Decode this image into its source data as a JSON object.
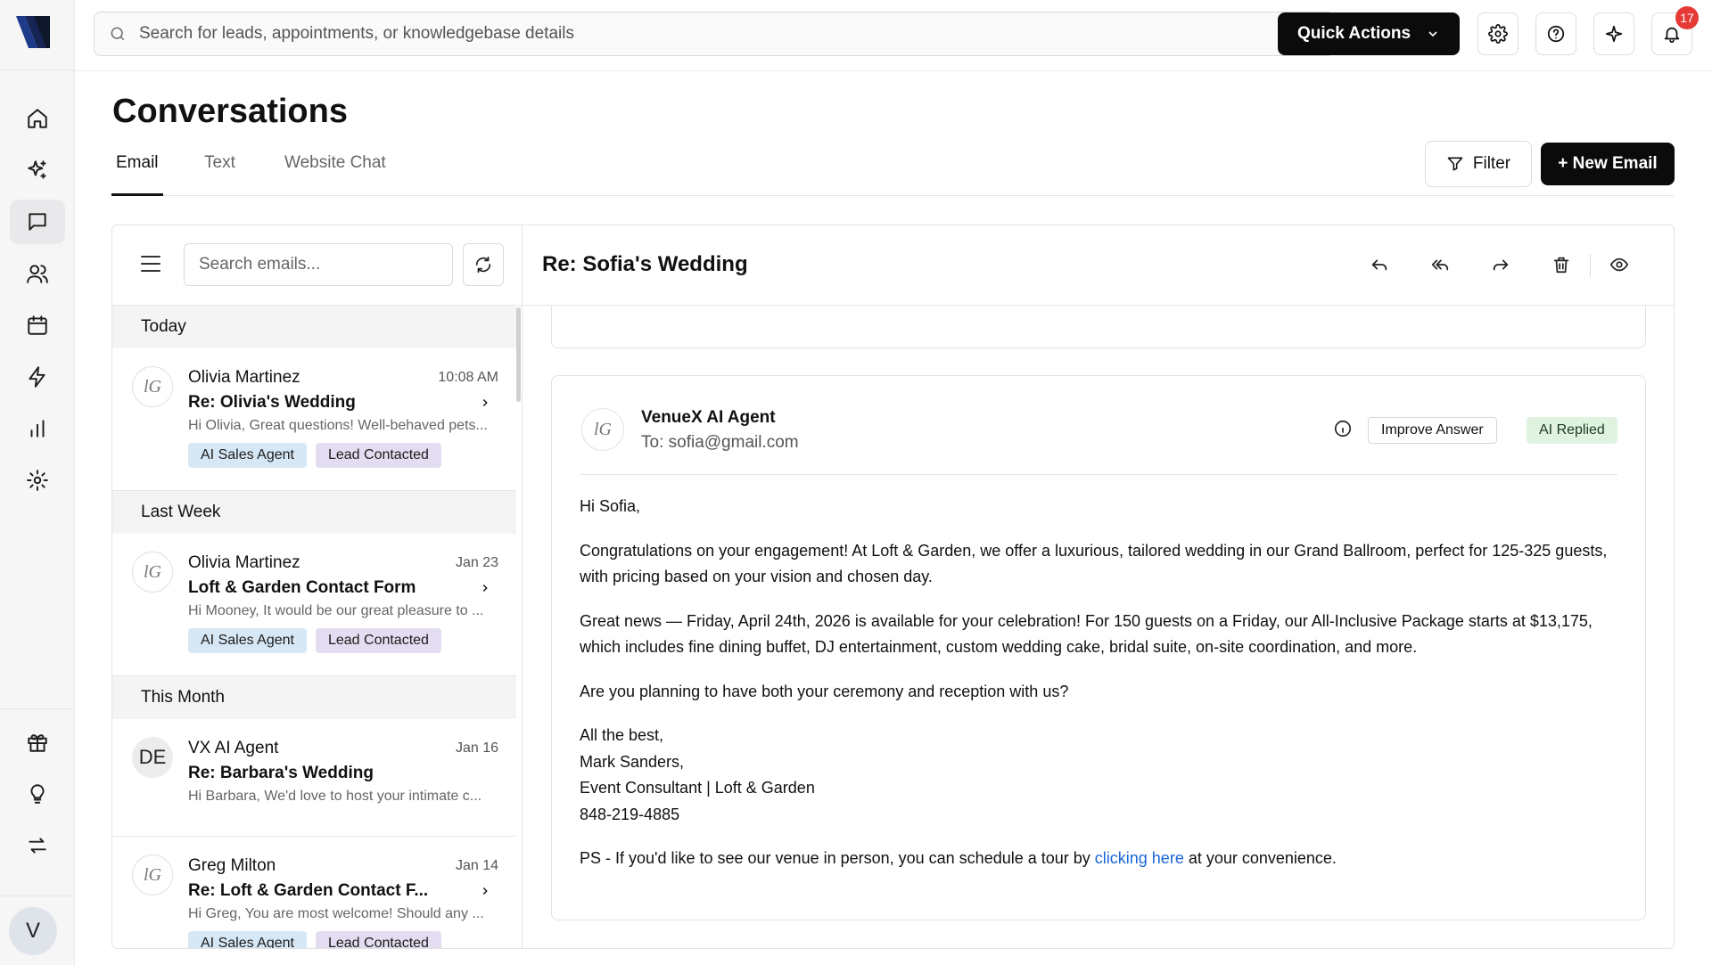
{
  "search": {
    "placeholder": "Search for leads, appointments, or knowledgebase details"
  },
  "topbar": {
    "quick_actions": "Quick Actions",
    "notification_count": "17"
  },
  "page": {
    "title": "Conversations",
    "tabs": [
      {
        "label": "Email",
        "active": true
      },
      {
        "label": "Text",
        "active": false
      },
      {
        "label": "Website Chat",
        "active": false
      }
    ],
    "filter_label": "Filter",
    "new_email_label": "+ New Email"
  },
  "sidebar": {
    "nav": [
      "home-icon",
      "sparkles-icon",
      "chat-icon",
      "users-icon",
      "calendar-icon",
      "lightning-icon",
      "bar-chart-icon",
      "settings-icon"
    ],
    "bottom": [
      "gift-icon",
      "lightbulb-icon",
      "swap-icon"
    ],
    "user_initial": "V"
  },
  "email_list": {
    "search_placeholder": "Search emails...",
    "groups": [
      {
        "label": "Today"
      },
      {
        "label": "Last Week"
      },
      {
        "label": "This Month"
      }
    ],
    "items": [
      {
        "sender": "Olivia Martinez",
        "time": "10:08 AM",
        "subject": "Re: Olivia's Wedding",
        "preview": "Hi Olivia, Great questions! Well-behaved pets...",
        "tags": [
          "AI Sales Agent",
          "Lead Contacted"
        ],
        "avatar": "lG"
      },
      {
        "sender": "Olivia Martinez",
        "time": "Jan 23",
        "subject": "Loft & Garden Contact Form",
        "preview": "Hi Mooney, It would be our great pleasure to ...",
        "tags": [
          "AI Sales Agent",
          "Lead Contacted"
        ],
        "avatar": "lG"
      },
      {
        "sender": "VX AI Agent",
        "time": "Jan 16",
        "subject": "Re: Barbara's Wedding",
        "preview": "Hi Barbara, We'd love to host your intimate c...",
        "tags": [],
        "avatar": "DE"
      },
      {
        "sender": "Greg Milton",
        "time": "Jan 14",
        "subject": "Re: Loft & Garden Contact F...",
        "preview": "Hi Greg, You are most welcome! Should any ...",
        "tags": [
          "AI Sales Agent",
          "Lead Contacted"
        ],
        "avatar": "lG"
      }
    ]
  },
  "reader": {
    "subject": "Re: Sofia's Wedding",
    "message": {
      "avatar": "lG",
      "from": "VenueX AI Agent",
      "to": "To: sofia@gmail.com",
      "improve_label": "Improve Answer",
      "status_label": "AI Replied",
      "greeting": "Hi Sofia,",
      "para1": "Congratulations on your engagement! At Loft & Garden, we offer a luxurious, tailored wedding in our Grand Ballroom, perfect for 125-325 guests, with pricing based on your vision and chosen day.",
      "para2": "Great news — Friday, April 24th, 2026 is available for your celebration! For 150 guests on a Friday, our All-Inclusive Package starts at $13,175, which includes fine dining buffet, DJ entertainment, custom wedding cake, bridal suite, on-site coordination, and more.",
      "para3": "Are you planning to have both your ceremony and reception with us?",
      "signoff": "All the best,",
      "sig_name": "Mark Sanders,",
      "sig_title": "Event Consultant | Loft & Garden",
      "sig_phone": "848-219-4885",
      "ps_before": "PS - If you'd like to see our venue in person, you can schedule a tour by ",
      "ps_link": "clicking here",
      "ps_after": " at your convenience."
    }
  },
  "colors": {
    "accent": "#0b0b0b",
    "tag_blue": "#d6e7f5",
    "tag_purple": "#e4ddf1",
    "ai_replied": "#dff3e0",
    "link": "#1a66d6",
    "badge": "#e53935"
  }
}
